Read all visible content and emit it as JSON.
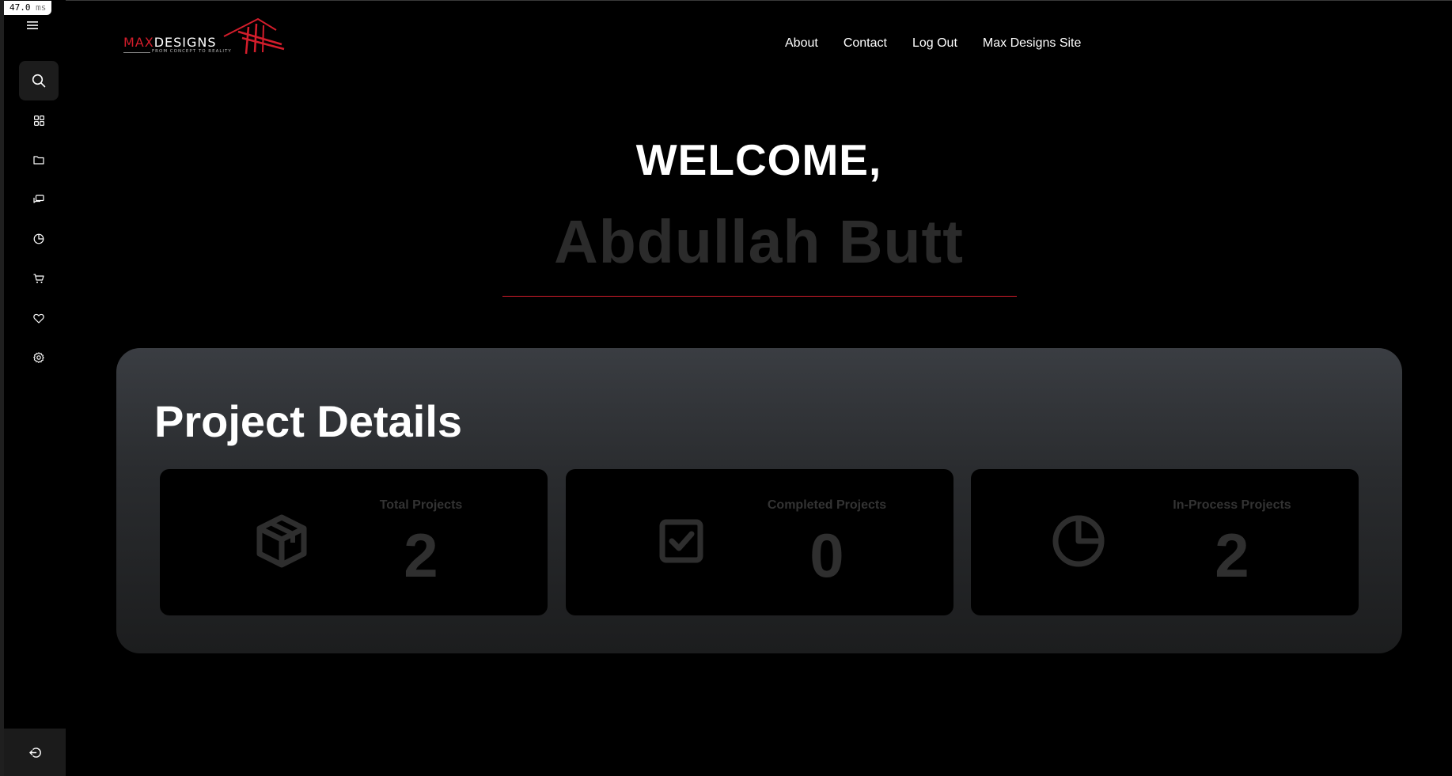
{
  "debug": {
    "frame_time": "47.0",
    "frame_unit": "ms"
  },
  "logo": {
    "word1": "MAX",
    "word2": "DESIGNS",
    "tagline": "FROM CONCEPT TO REALITY"
  },
  "nav": {
    "about": "About",
    "contact": "Contact",
    "logout": "Log Out",
    "site": "Max Designs Site"
  },
  "sidebar": {
    "items": [
      {
        "icon": "search-icon"
      },
      {
        "icon": "dashboard-grid-icon"
      },
      {
        "icon": "folder-icon"
      },
      {
        "icon": "chat-bubbles-icon"
      },
      {
        "icon": "pie-chart-icon"
      },
      {
        "icon": "cart-icon"
      },
      {
        "icon": "heart-icon"
      },
      {
        "icon": "gear-icon"
      }
    ],
    "bottom_icon": "logout-icon"
  },
  "hero": {
    "greeting": "WELCOME,",
    "user_name": "Abdullah Butt"
  },
  "project_details": {
    "title": "Project Details",
    "cards": [
      {
        "label": "Total Projects",
        "value": "2",
        "icon": "box-icon"
      },
      {
        "label": "Completed Projects",
        "value": "0",
        "icon": "check-square-icon"
      },
      {
        "label": "In-Process Projects",
        "value": "2",
        "icon": "pie-chart-icon"
      }
    ]
  },
  "colors": {
    "accent": "#d31d2b",
    "background": "#000000",
    "panel": "#2e3033",
    "muted_text": "#2b2b2b"
  }
}
